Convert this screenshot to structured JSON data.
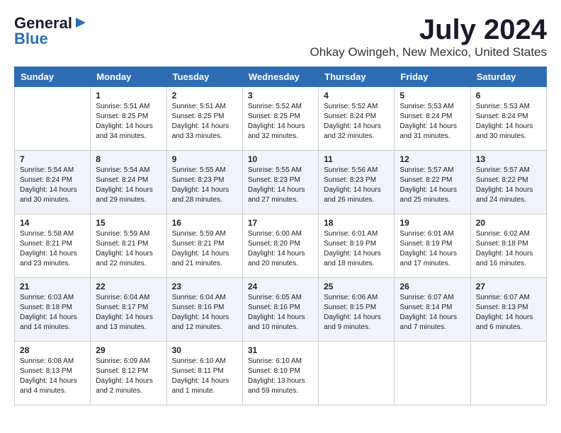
{
  "header": {
    "logo_general": "General",
    "logo_blue": "Blue",
    "month_title": "July 2024",
    "location": "Ohkay Owingeh, New Mexico, United States"
  },
  "days_of_week": [
    "Sunday",
    "Monday",
    "Tuesday",
    "Wednesday",
    "Thursday",
    "Friday",
    "Saturday"
  ],
  "weeks": [
    [
      {
        "day": "",
        "info": ""
      },
      {
        "day": "1",
        "info": "Sunrise: 5:51 AM\nSunset: 8:25 PM\nDaylight: 14 hours\nand 34 minutes."
      },
      {
        "day": "2",
        "info": "Sunrise: 5:51 AM\nSunset: 8:25 PM\nDaylight: 14 hours\nand 33 minutes."
      },
      {
        "day": "3",
        "info": "Sunrise: 5:52 AM\nSunset: 8:25 PM\nDaylight: 14 hours\nand 32 minutes."
      },
      {
        "day": "4",
        "info": "Sunrise: 5:52 AM\nSunset: 8:24 PM\nDaylight: 14 hours\nand 32 minutes."
      },
      {
        "day": "5",
        "info": "Sunrise: 5:53 AM\nSunset: 8:24 PM\nDaylight: 14 hours\nand 31 minutes."
      },
      {
        "day": "6",
        "info": "Sunrise: 5:53 AM\nSunset: 8:24 PM\nDaylight: 14 hours\nand 30 minutes."
      }
    ],
    [
      {
        "day": "7",
        "info": "Sunrise: 5:54 AM\nSunset: 8:24 PM\nDaylight: 14 hours\nand 30 minutes."
      },
      {
        "day": "8",
        "info": "Sunrise: 5:54 AM\nSunset: 8:24 PM\nDaylight: 14 hours\nand 29 minutes."
      },
      {
        "day": "9",
        "info": "Sunrise: 5:55 AM\nSunset: 8:23 PM\nDaylight: 14 hours\nand 28 minutes."
      },
      {
        "day": "10",
        "info": "Sunrise: 5:55 AM\nSunset: 8:23 PM\nDaylight: 14 hours\nand 27 minutes."
      },
      {
        "day": "11",
        "info": "Sunrise: 5:56 AM\nSunset: 8:23 PM\nDaylight: 14 hours\nand 26 minutes."
      },
      {
        "day": "12",
        "info": "Sunrise: 5:57 AM\nSunset: 8:22 PM\nDaylight: 14 hours\nand 25 minutes."
      },
      {
        "day": "13",
        "info": "Sunrise: 5:57 AM\nSunset: 8:22 PM\nDaylight: 14 hours\nand 24 minutes."
      }
    ],
    [
      {
        "day": "14",
        "info": "Sunrise: 5:58 AM\nSunset: 8:21 PM\nDaylight: 14 hours\nand 23 minutes."
      },
      {
        "day": "15",
        "info": "Sunrise: 5:59 AM\nSunset: 8:21 PM\nDaylight: 14 hours\nand 22 minutes."
      },
      {
        "day": "16",
        "info": "Sunrise: 5:59 AM\nSunset: 8:21 PM\nDaylight: 14 hours\nand 21 minutes."
      },
      {
        "day": "17",
        "info": "Sunrise: 6:00 AM\nSunset: 8:20 PM\nDaylight: 14 hours\nand 20 minutes."
      },
      {
        "day": "18",
        "info": "Sunrise: 6:01 AM\nSunset: 8:19 PM\nDaylight: 14 hours\nand 18 minutes."
      },
      {
        "day": "19",
        "info": "Sunrise: 6:01 AM\nSunset: 8:19 PM\nDaylight: 14 hours\nand 17 minutes."
      },
      {
        "day": "20",
        "info": "Sunrise: 6:02 AM\nSunset: 8:18 PM\nDaylight: 14 hours\nand 16 minutes."
      }
    ],
    [
      {
        "day": "21",
        "info": "Sunrise: 6:03 AM\nSunset: 8:18 PM\nDaylight: 14 hours\nand 14 minutes."
      },
      {
        "day": "22",
        "info": "Sunrise: 6:04 AM\nSunset: 8:17 PM\nDaylight: 14 hours\nand 13 minutes."
      },
      {
        "day": "23",
        "info": "Sunrise: 6:04 AM\nSunset: 8:16 PM\nDaylight: 14 hours\nand 12 minutes."
      },
      {
        "day": "24",
        "info": "Sunrise: 6:05 AM\nSunset: 8:16 PM\nDaylight: 14 hours\nand 10 minutes."
      },
      {
        "day": "25",
        "info": "Sunrise: 6:06 AM\nSunset: 8:15 PM\nDaylight: 14 hours\nand 9 minutes."
      },
      {
        "day": "26",
        "info": "Sunrise: 6:07 AM\nSunset: 8:14 PM\nDaylight: 14 hours\nand 7 minutes."
      },
      {
        "day": "27",
        "info": "Sunrise: 6:07 AM\nSunset: 8:13 PM\nDaylight: 14 hours\nand 6 minutes."
      }
    ],
    [
      {
        "day": "28",
        "info": "Sunrise: 6:08 AM\nSunset: 8:13 PM\nDaylight: 14 hours\nand 4 minutes."
      },
      {
        "day": "29",
        "info": "Sunrise: 6:09 AM\nSunset: 8:12 PM\nDaylight: 14 hours\nand 2 minutes."
      },
      {
        "day": "30",
        "info": "Sunrise: 6:10 AM\nSunset: 8:11 PM\nDaylight: 14 hours\nand 1 minute."
      },
      {
        "day": "31",
        "info": "Sunrise: 6:10 AM\nSunset: 8:10 PM\nDaylight: 13 hours\nand 59 minutes."
      },
      {
        "day": "",
        "info": ""
      },
      {
        "day": "",
        "info": ""
      },
      {
        "day": "",
        "info": ""
      }
    ]
  ]
}
